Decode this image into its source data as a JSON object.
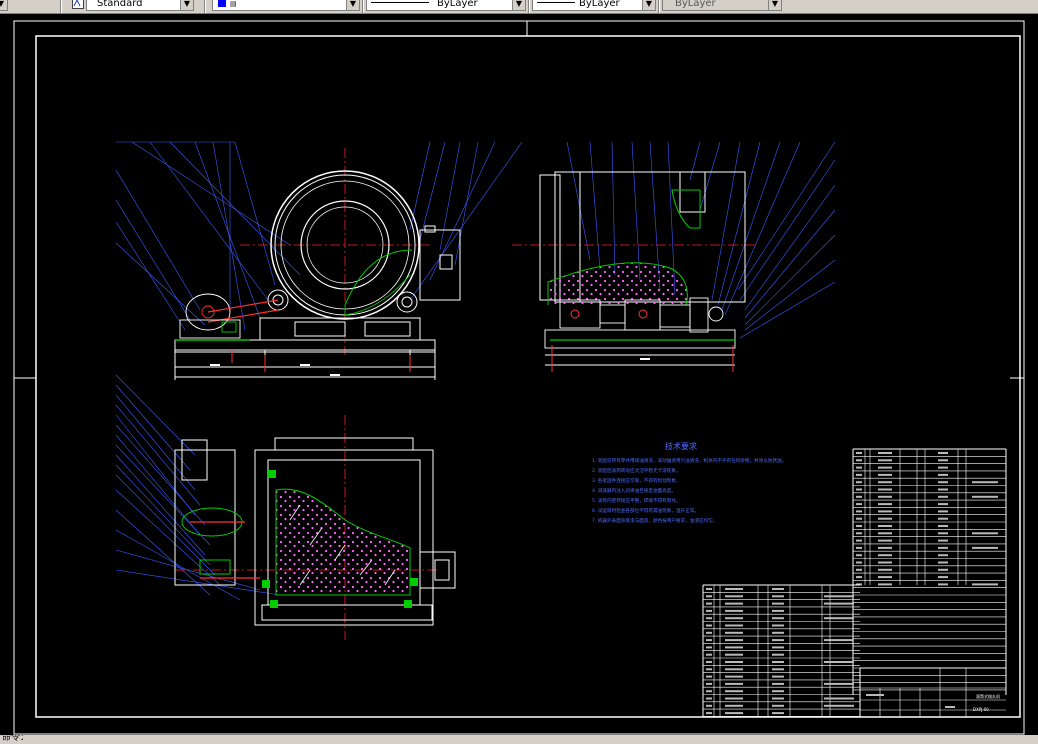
{
  "toolbar": {
    "text_style": "Standard",
    "linetype": "ByLayer",
    "lineweight": "ByLayer",
    "plot_style": "ByLayer"
  },
  "drawing": {
    "tech_requirements_title": "技术要求",
    "tech_requirements": [
      "1. 装配前所有零件用煤油清洗，滚动轴承用汽油清洗，机体内不许有任何杂物，并涂以防锈油。",
      "2. 装配后滚筒转动应灵活平稳无卡滞现象。",
      "3. 各紧固件连接应可靠，不得有松动现象。",
      "4. 减速器内注入润滑油至规定油面高度。",
      "5. 滚筒内壁焊接应平整，焊缝不得有裂纹。",
      "6. 试运转时检查各部位不得有漏油现象，温升正常。",
      "7. 机器外表面涂底漆与面漆，颜色按用户要求，油漆应均匀。"
    ],
    "title_block": {
      "name": "滚筒式抛丸机",
      "drawing_no": "DXPJ-00"
    }
  },
  "colors": {
    "background": "#000000",
    "outline": "#ffffff",
    "leader": "#3b5bff",
    "centerline": "#ff2020",
    "wear_liner": "#00cc00",
    "steel_shot": "#ff66ff",
    "accent_red": "#ff3030"
  },
  "status": {
    "command_prompt": "命令："
  }
}
